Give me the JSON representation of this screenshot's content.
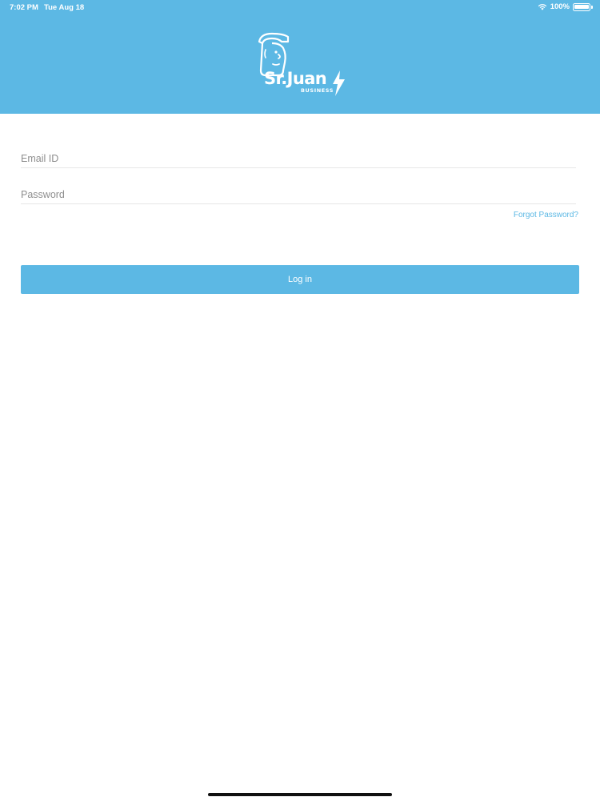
{
  "status_bar": {
    "time": "7:02 PM",
    "date": "Tue Aug 18",
    "battery": "100%",
    "wifi_icon": "wifi-icon",
    "battery_icon": "battery-icon"
  },
  "brand": {
    "name": "Sr.Juan",
    "sub": "BUSINESS",
    "color": "#5cb8e4"
  },
  "form": {
    "email_placeholder": "Email ID",
    "email_value": "",
    "password_placeholder": "Password",
    "password_value": "",
    "forgot_label": "Forgot Password?",
    "login_label": "Log in"
  }
}
